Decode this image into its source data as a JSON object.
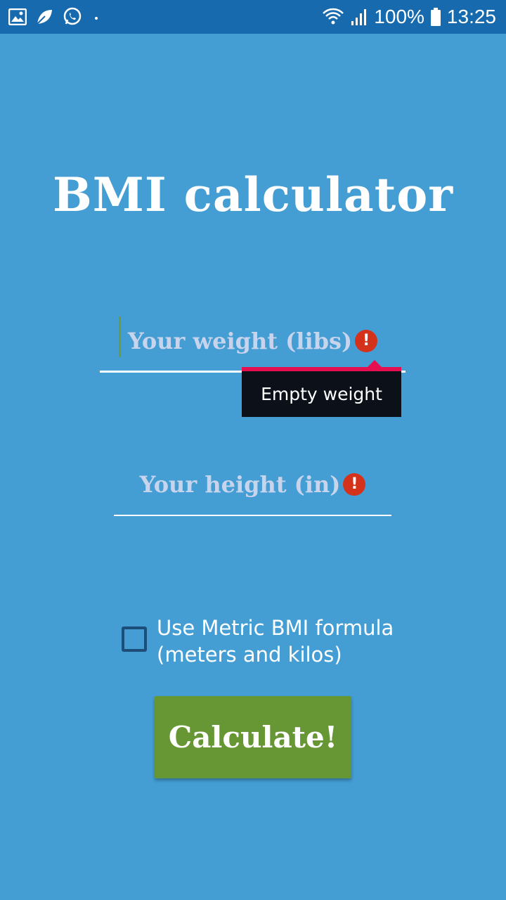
{
  "status_bar": {
    "battery": "100%",
    "time": "13:25",
    "left_icons": [
      "gallery-icon",
      "leaf-icon",
      "whatsapp-icon",
      "dot-icon"
    ],
    "right_icons": [
      "wifi-icon",
      "signal-icon",
      "battery-icon"
    ]
  },
  "app": {
    "title": "BMI calculator"
  },
  "weight_field": {
    "placeholder": "Your weight (libs)",
    "error_icon": "!",
    "error_tooltip": "Empty weight"
  },
  "height_field": {
    "placeholder": "Your height (in)",
    "error_icon": "!"
  },
  "metric_option": {
    "label_line1": "Use Metric BMI formula",
    "label_line2": "(meters and kilos)",
    "checked": false
  },
  "calculate_button": {
    "label": "Calculate!"
  },
  "colors": {
    "background": "#449ed4",
    "status_bar": "#176aad",
    "button": "#679735",
    "error": "#d5321c",
    "tooltip_accent": "#e60f4f"
  }
}
